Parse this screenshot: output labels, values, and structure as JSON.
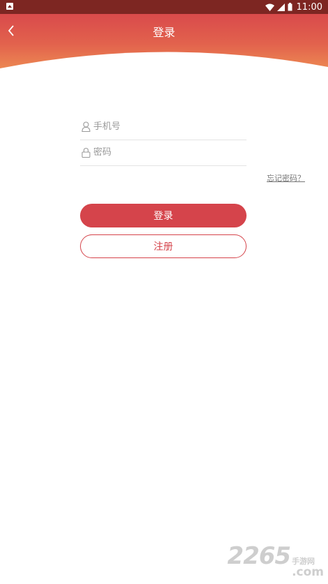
{
  "status_bar": {
    "time": "11:00"
  },
  "header": {
    "title": "登录",
    "back_icon": "chevron-left-icon"
  },
  "form": {
    "phone_placeholder": "手机号",
    "phone_icon": "user-icon",
    "password_placeholder": "密码",
    "password_icon": "lock-icon",
    "forgot_label": "忘记密码？"
  },
  "buttons": {
    "login_label": "登录",
    "register_label": "注册"
  },
  "watermark": {
    "number": "2265",
    "brand_cn": "手游网",
    "domain": ".com"
  },
  "colors": {
    "accent": "#d5444b",
    "header_top": "#d94a4b",
    "header_bottom": "#ec8752",
    "status_bar": "#7d2622"
  }
}
